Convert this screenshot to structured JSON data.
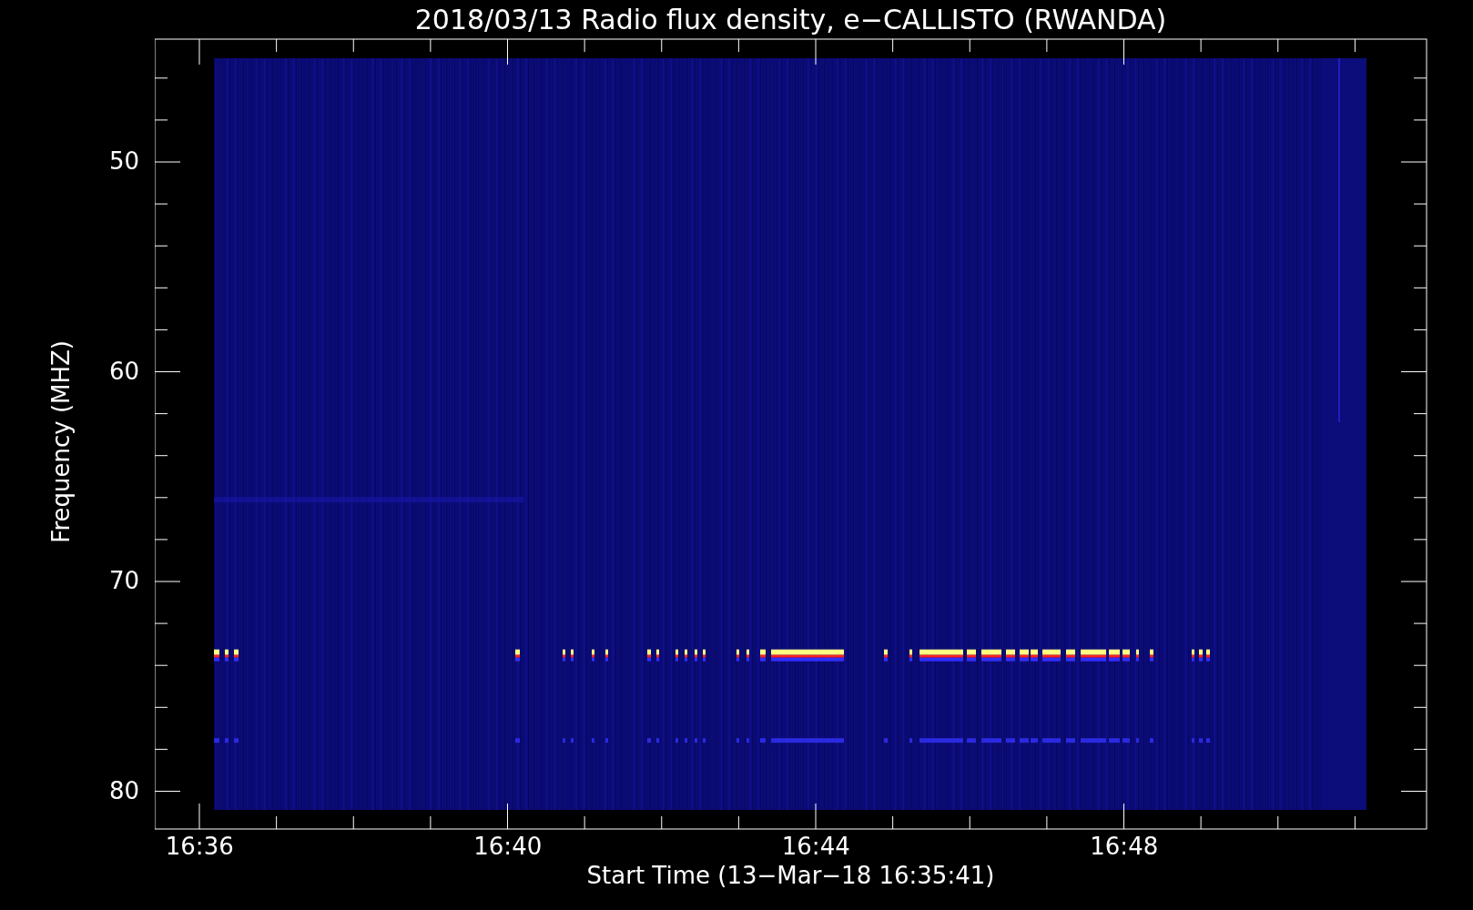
{
  "plot": {
    "title": "2018/03/13  Radio flux density, e−CALLISTO (RWANDA)",
    "xlabel": "Start Time (13−Mar−18 16:35:41)",
    "ylabel": "Frequency (MHZ)",
    "xtick_labels": [
      "16:36",
      "16:40",
      "16:44",
      "16:48"
    ],
    "ytick_labels": [
      "50",
      "60",
      "70",
      "80"
    ]
  }
}
